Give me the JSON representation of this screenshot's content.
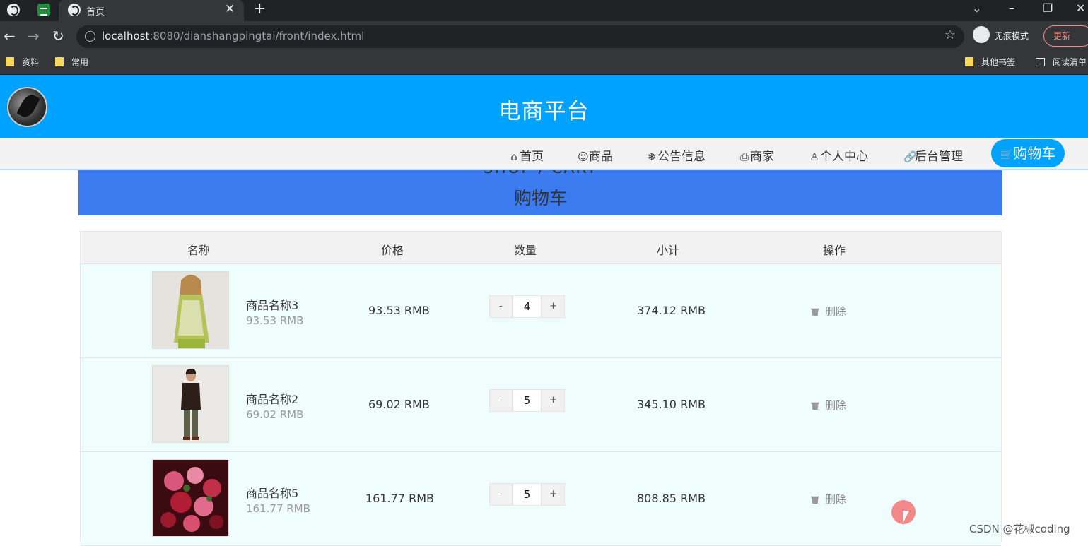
{
  "browser": {
    "tab_title": "首页",
    "tab_close": "✕",
    "new_tab": "+",
    "url_host": "localhost",
    "url_rest": ":8080/dianshangpingtai/front/index.html",
    "incognito_label": "无痕模式",
    "update_label": "更新",
    "bookmarks": [
      "资料",
      "常用"
    ],
    "bookmarks_right": [
      "其他书签",
      "阅读清单"
    ],
    "icons": [
      "back-icon",
      "forward-icon",
      "reload-icon",
      "star-icon"
    ]
  },
  "header": {
    "title": "电商平台"
  },
  "nav": {
    "items": [
      {
        "icon": "⌂",
        "label": "首页"
      },
      {
        "icon": "☺",
        "label": "商品"
      },
      {
        "icon": "❄",
        "label": "公告信息"
      },
      {
        "icon": "⎙",
        "label": "商家"
      },
      {
        "icon": "♙",
        "label": "个人中心"
      },
      {
        "icon": "🔗",
        "label": "后台管理"
      }
    ],
    "cart": {
      "icon": "🛒",
      "label": "购物车"
    }
  },
  "banner": {
    "en": "SHOP / CART",
    "cn": "购物车"
  },
  "table": {
    "headers": [
      "名称",
      "价格",
      "数量",
      "小计",
      "操作"
    ],
    "rows": [
      {
        "name": "商品名称3",
        "unit_price": "93.53 RMB",
        "price": "93.53 RMB",
        "qty": "4",
        "subtotal": "374.12 RMB",
        "action": "删除"
      },
      {
        "name": "商品名称2",
        "unit_price": "69.02 RMB",
        "price": "69.02 RMB",
        "qty": "5",
        "subtotal": "345.10 RMB",
        "action": "删除"
      },
      {
        "name": "商品名称5",
        "unit_price": "161.77 RMB",
        "price": "161.77 RMB",
        "qty": "5",
        "subtotal": "808.85 RMB",
        "action": "删除"
      }
    ],
    "minus": "-",
    "plus": "+"
  },
  "watermark": "CSDN @花椒coding"
}
